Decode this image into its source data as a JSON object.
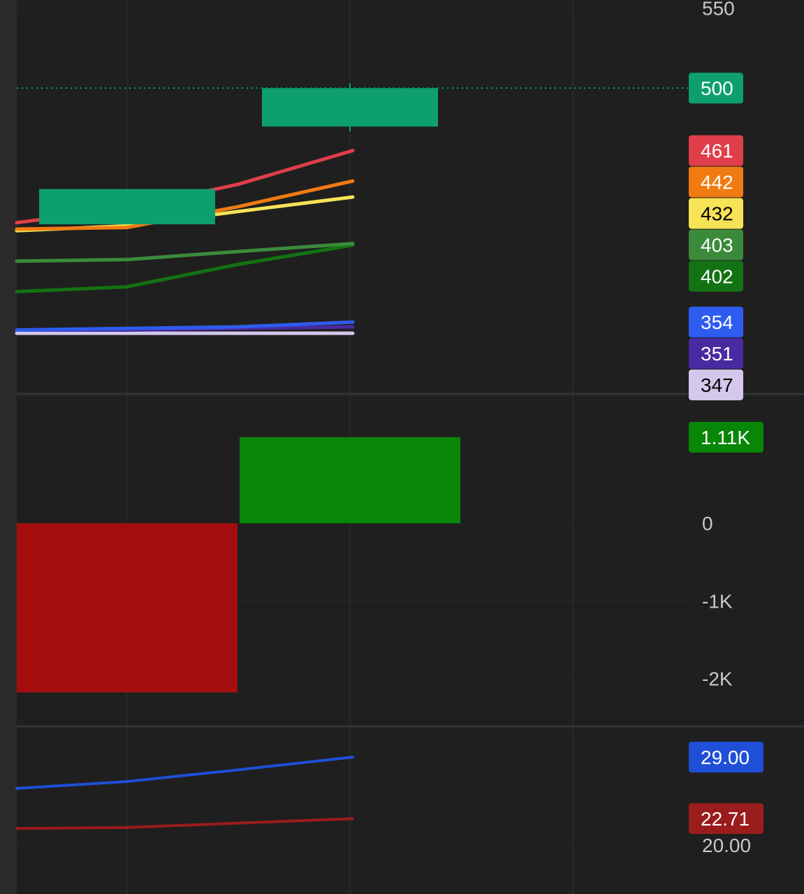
{
  "colors": {
    "background": "#1f1f1f",
    "left_strip": "#2a2a2a",
    "grid": "#282828",
    "separator": "#33343b"
  },
  "chart_data": [
    {
      "type": "candlestick",
      "panel": "price",
      "ylim": [
        310,
        555
      ],
      "y_ticks": [
        {
          "value": 550,
          "label": "550"
        }
      ],
      "current_price": {
        "value": 500,
        "label": "500",
        "color": "#0e9f6e",
        "text_color": "#ffffff",
        "line_style": "dotted"
      },
      "candles": [
        {
          "index": 0,
          "open": 415,
          "high": 437,
          "low": 415,
          "close": 437,
          "color": "#0e9f6e"
        },
        {
          "index": 1,
          "open": 476,
          "high": 503,
          "low": 473,
          "close": 500,
          "color": "#0e9f6e"
        }
      ],
      "series": [
        {
          "values": [
            416,
            425,
            440,
            461
          ],
          "color": "#e03e4a",
          "label": "461",
          "text_color": "#ffffff"
        },
        {
          "values": [
            412,
            413,
            426,
            442
          ],
          "color": "#f07b12",
          "label": "442",
          "text_color": "#ffffff"
        },
        {
          "values": [
            411,
            414,
            423,
            432
          ],
          "color": "#f6e356",
          "label": "432",
          "text_color": "#000000"
        },
        {
          "values": [
            392,
            393,
            398,
            403
          ],
          "color": "#3b8a3b",
          "label": "403",
          "text_color": "#ffffff"
        },
        {
          "values": [
            373,
            376,
            390,
            402
          ],
          "color": "#137213",
          "label": "402",
          "text_color": "#ffffff"
        },
        {
          "values": [
            349,
            350,
            351,
            354
          ],
          "color": "#2e5cf0",
          "label": "354",
          "text_color": "#ffffff"
        },
        {
          "values": [
            349,
            349,
            350,
            351
          ],
          "color": "#4a2aa0",
          "label": "351",
          "text_color": "#ffffff"
        },
        {
          "values": [
            347,
            347,
            347,
            347
          ],
          "color": "#d3c8ec",
          "label": "347",
          "text_color": "#000000"
        }
      ]
    },
    {
      "type": "bar",
      "panel": "histogram",
      "ylim": [
        -2600,
        1650
      ],
      "y_ticks": [
        {
          "value": 0,
          "label": "0"
        },
        {
          "value": -1000,
          "label": "-1K"
        },
        {
          "value": -2000,
          "label": "-2K"
        }
      ],
      "bars": [
        {
          "index": 0,
          "value": -2180,
          "color": "#a40e0e"
        },
        {
          "index": 1,
          "value": 1110,
          "color": "#078607"
        }
      ],
      "last_value": {
        "value": 1110,
        "label": "1.11K",
        "color": "#078607",
        "text_color": "#ffffff"
      }
    },
    {
      "type": "line",
      "panel": "indicator",
      "ylim": [
        15,
        32
      ],
      "y_ticks": [
        {
          "value": 20,
          "label": "20.00"
        }
      ],
      "series": [
        {
          "values": [
            25.8,
            26.5,
            27.7,
            29.0
          ],
          "color": "#1f4fd6",
          "label": "29.00",
          "text_color": "#ffffff"
        },
        {
          "values": [
            21.7,
            21.8,
            22.25,
            22.71
          ],
          "color": "#9b1c1c",
          "label": "22.71",
          "text_color": "#ffffff"
        }
      ]
    }
  ]
}
